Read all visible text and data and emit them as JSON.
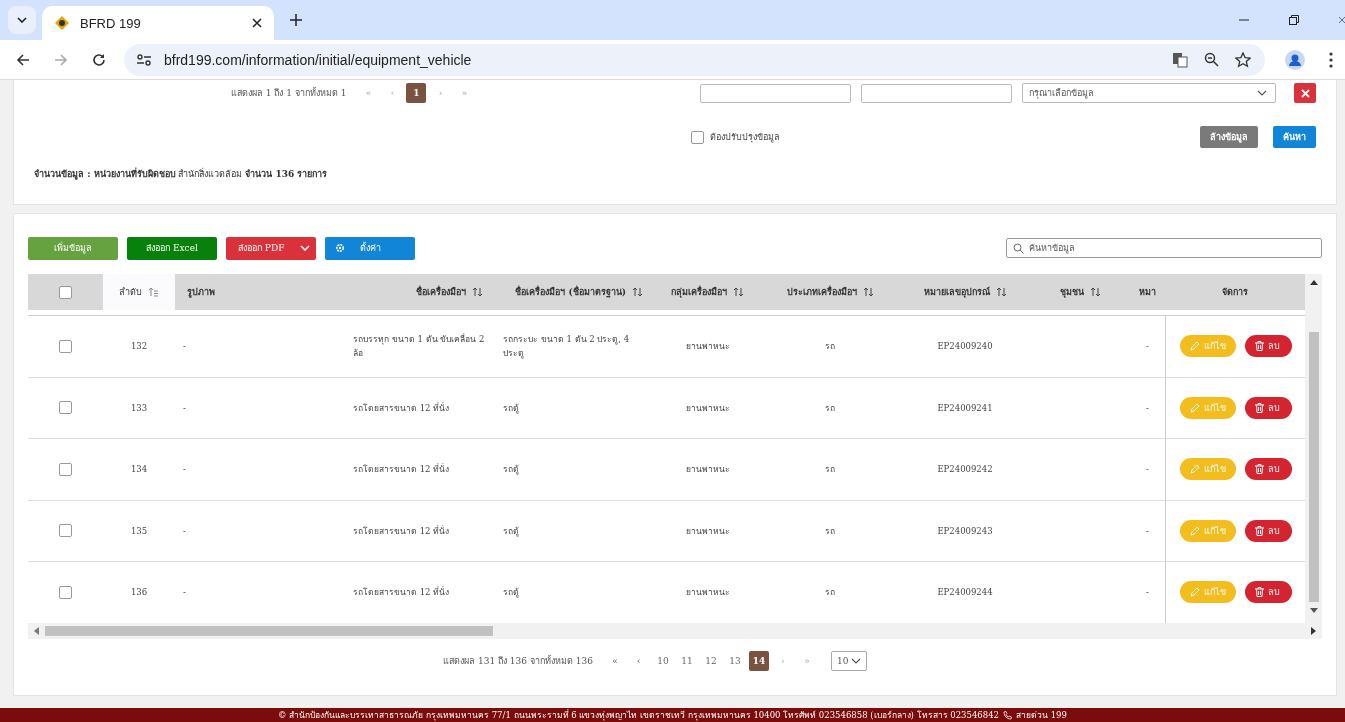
{
  "browser": {
    "tab_title": "BFRD 199",
    "url": "bfrd199.com/information/initial/equipment_vehicle"
  },
  "filter": {
    "pagination": {
      "summary": "แสดงผล 1 ถึง 1 จากทั้งหมด 1",
      "first": "«",
      "prev": "‹",
      "next": "›",
      "last": "»",
      "pages": [
        {
          "label": "1",
          "selected": true
        }
      ]
    },
    "select_placeholder": "กรุณาเลือกข้อมูล",
    "needs_update": {
      "label": "ต้องปรับปรุงข้อมูล",
      "checked": false
    },
    "clear_button": "ล้างข้อมูล",
    "search_button": "ค้นหา",
    "summary": "**จำนวนข้อมูล :  หน่วยงานที่รับผิดชอบ** สำนักสิ่งแวดล้อม  **จำนวน 136 รายการ**"
  },
  "toolbar": [
    {
      "kind": "add",
      "label": "เพิ่มข้อมูล"
    },
    {
      "kind": "excel",
      "label": "ส่งออก Excel"
    },
    {
      "kind": "pdf",
      "label": "ส่งออก PDF"
    },
    {
      "kind": "settings",
      "label": "ตั้งค่า"
    }
  ],
  "table_search_placeholder": "ค้นหาข้อมูล",
  "columns": [
    {
      "kind": "check",
      "checked": false
    },
    {
      "label": "ลำดับ",
      "sortable": true,
      "sorted": true
    },
    {
      "label": "รูปภาพ",
      "sortable": false,
      "sorted": false
    },
    {
      "label": "ชื่อเครื่องมือฯ",
      "sortable": true,
      "sorted": false
    },
    {
      "label": "ชื่อเครื่องมือฯ (ชื่อมาตรฐาน)",
      "sortable": true,
      "sorted": false
    },
    {
      "label": "กลุ่มเครื่องมือฯ",
      "sortable": true,
      "sorted": false
    },
    {
      "label": "ประเภทเครื่องมือฯ",
      "sortable": true,
      "sorted": false
    },
    {
      "label": "หมายเลขอุปกรณ์",
      "sortable": true,
      "sorted": false
    },
    {
      "label": "ชุมชน",
      "sortable": true,
      "sorted": false
    },
    {
      "label": "หมา",
      "sortable": false,
      "sorted": false
    },
    {
      "label": "จัดการ",
      "sortable": false,
      "sorted": false
    }
  ],
  "rows": [
    {
      "checked": false,
      "no": "132",
      "image": "-",
      "name": "รถบรรทุก ขนาด 1 ตัน ขับเคลื่อน 2 ล้อ",
      "standard": "รถกระบะ ขนาด 1 ตัน 2 ประตู, 4 ประตู",
      "group": "ยานพาหนะ",
      "type": "รถ",
      "code": "EP24009240",
      "column_10": "-",
      "edit": "แก้ไข",
      "delete": "ลบ"
    },
    {
      "checked": false,
      "no": "133",
      "image": "-",
      "name": "รถโดยสารขนาด 12 ที่นั่ง",
      "standard": "รถตู้",
      "group": "ยานพาหนะ",
      "type": "รถ",
      "code": "EP24009241",
      "column_10": "-",
      "edit": "แก้ไข",
      "delete": "ลบ"
    },
    {
      "checked": false,
      "no": "134",
      "image": "-",
      "name": "รถโดยสารขนาด 12 ที่นั่ง",
      "standard": "รถตู้",
      "group": "ยานพาหนะ",
      "type": "รถ",
      "code": "EP24009242",
      "column_10": "-",
      "edit": "แก้ไข",
      "delete": "ลบ"
    },
    {
      "checked": false,
      "no": "135",
      "image": "-",
      "name": "รถโดยสารขนาด 12 ที่นั่ง",
      "standard": "รถตู้",
      "group": "ยานพาหนะ",
      "type": "รถ",
      "code": "EP24009243",
      "column_10": "-",
      "edit": "แก้ไข",
      "delete": "ลบ"
    },
    {
      "checked": false,
      "no": "136",
      "image": "-",
      "name": "รถโดยสารขนาด 12 ที่นั่ง",
      "standard": "รถตู้",
      "group": "ยานพาหนะ",
      "type": "รถ",
      "code": "EP24009244",
      "column_10": "-",
      "edit": "แก้ไข",
      "delete": "ลบ"
    }
  ],
  "pagination": {
    "summary": "แสดงผล 131 ถึง 136 จากทั้งหมด 136",
    "first": "«",
    "prev": "‹",
    "next": "›",
    "last": "»",
    "pages": [
      {
        "label": "10",
        "selected": false
      },
      {
        "label": "11",
        "selected": false
      },
      {
        "label": "12",
        "selected": false
      },
      {
        "label": "13",
        "selected": false
      },
      {
        "label": "14",
        "selected": true
      }
    ],
    "page_size": "10"
  },
  "footer": {
    "address": "© สำนักป้องกันและบรรเทาสาธารณภัย กรุงเทพมหานคร 77/1 ถนนพระรามที่ 6 แขวงทุ่งพญาไท เขตราชเทวี กรุงเทพมหานคร 10400 โทรศัพท์ 023546858 (เบอร์กลาง) โทรสาร 023546842",
    "hotline": "สายด่วน 199"
  }
}
